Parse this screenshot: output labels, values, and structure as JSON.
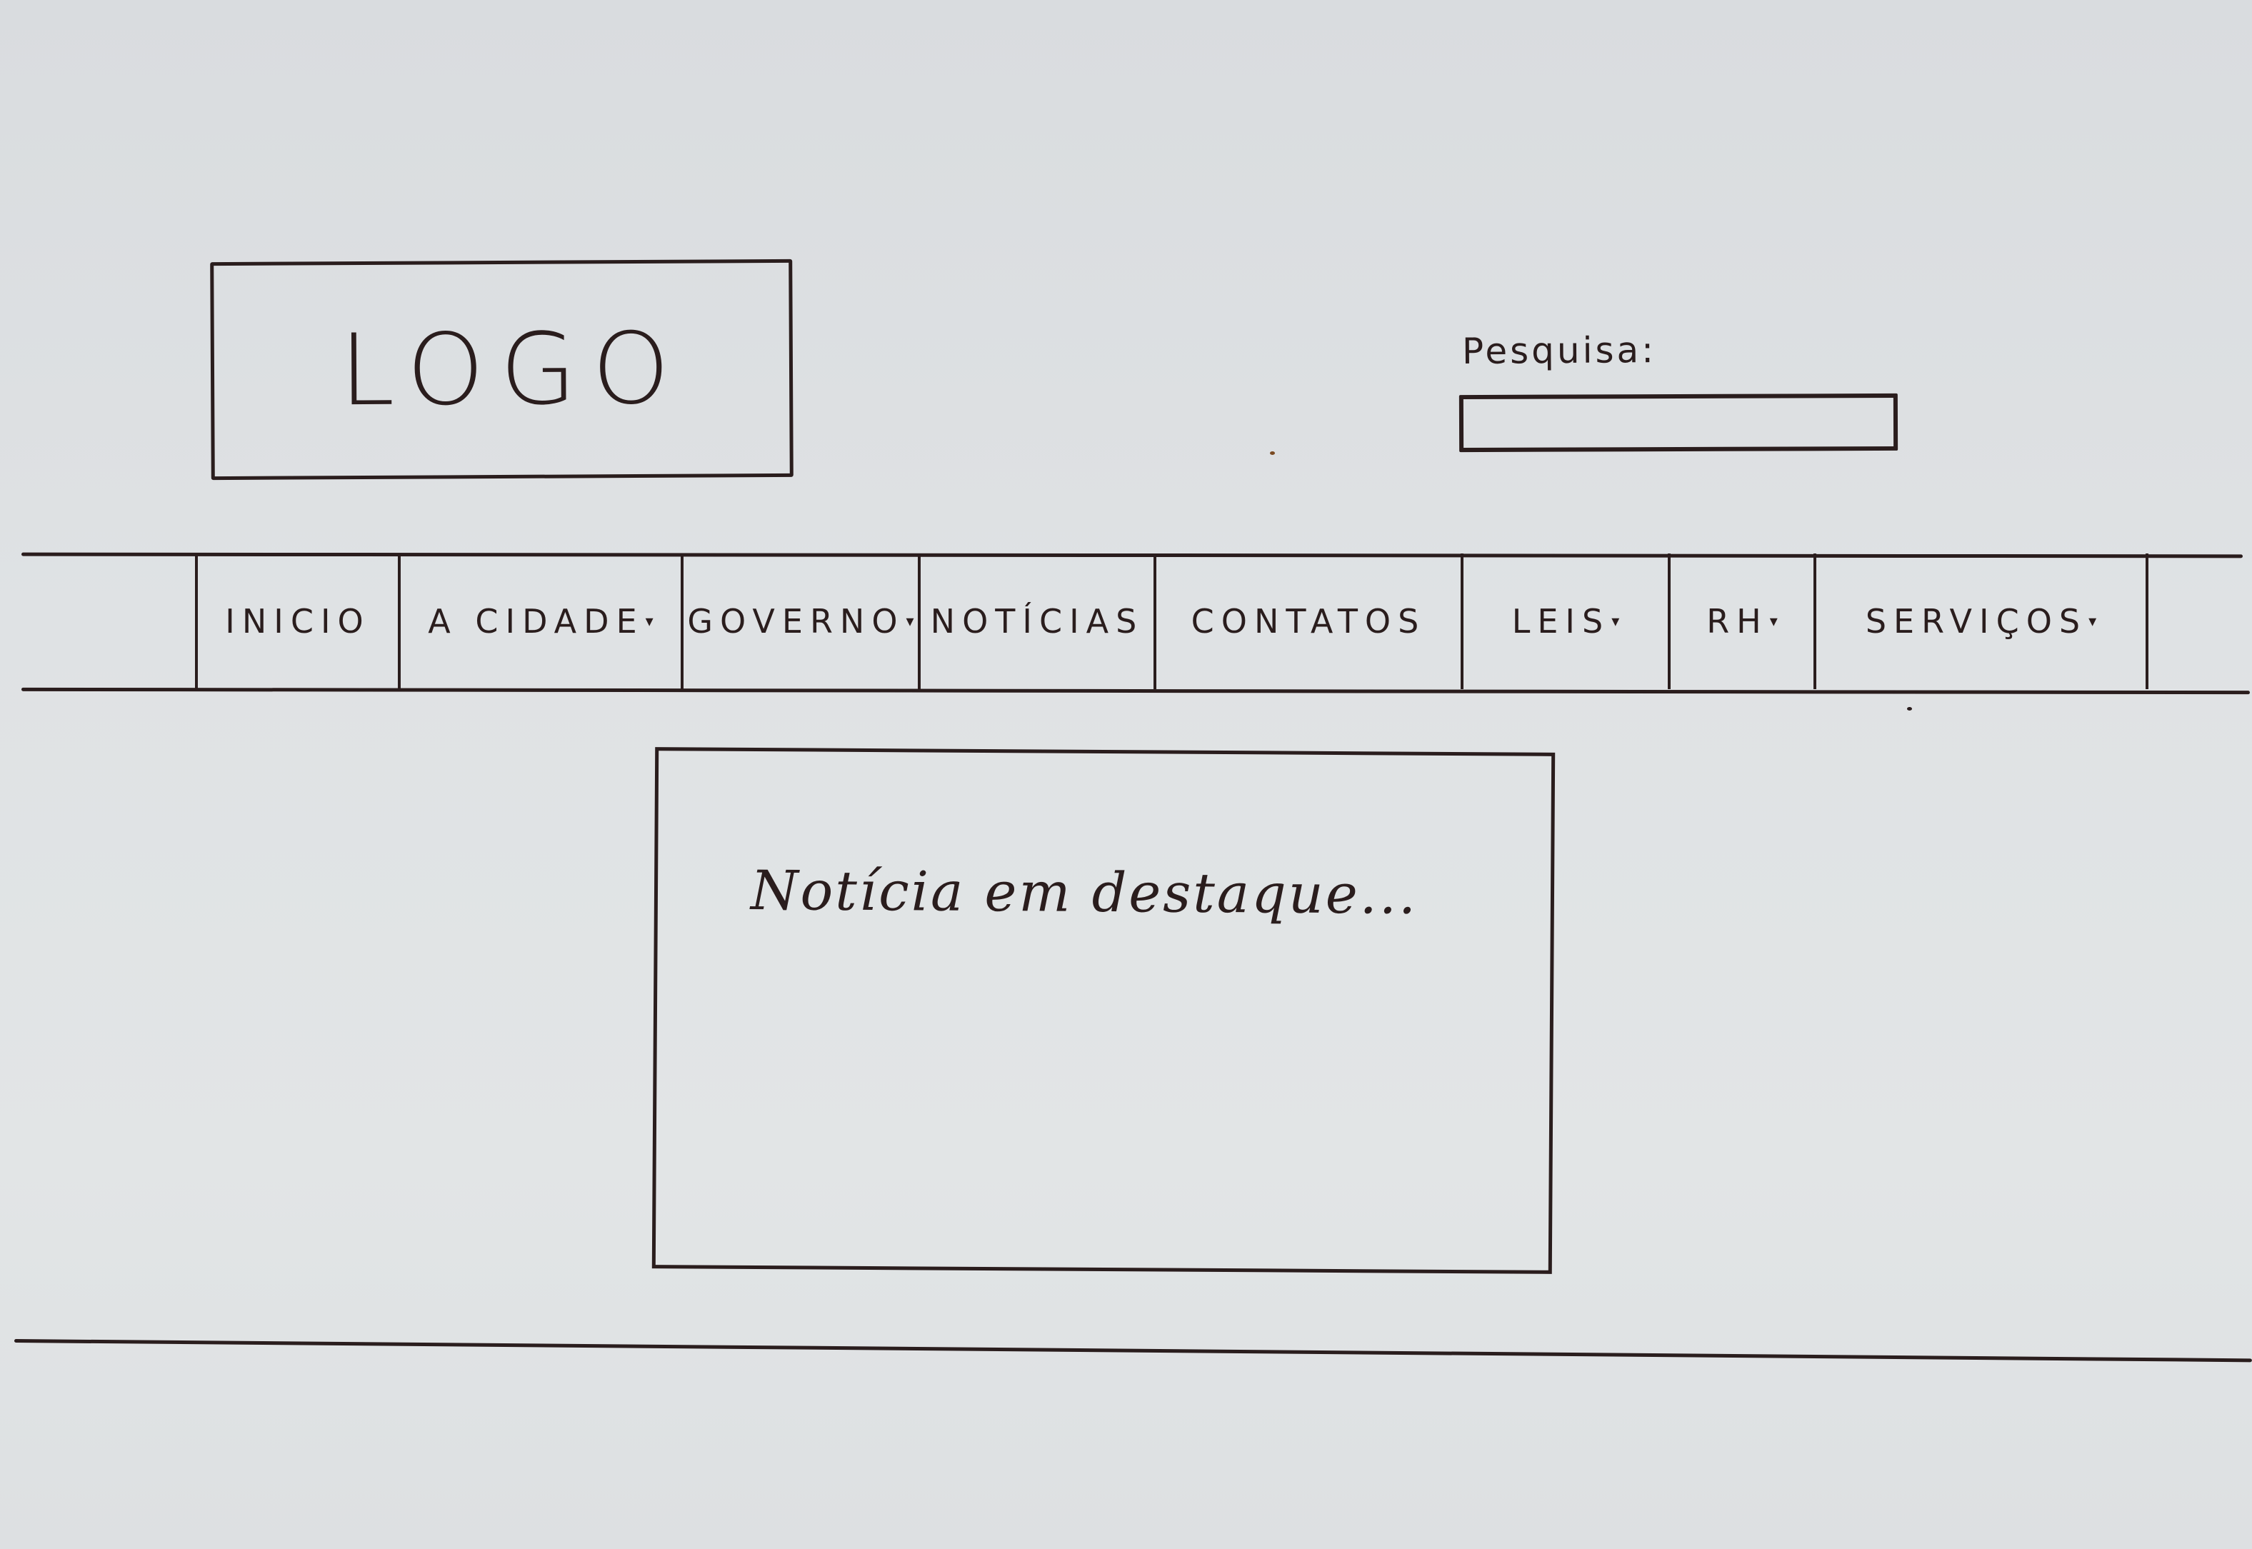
{
  "header": {
    "logo_text": "LOGO",
    "search": {
      "label": "Pesquisa:",
      "value": "",
      "placeholder": ""
    }
  },
  "nav": {
    "items": [
      {
        "label": "INICIO",
        "has_dropdown": false
      },
      {
        "label": "A CIDADE",
        "has_dropdown": true
      },
      {
        "label": "GOVERNO",
        "has_dropdown": true
      },
      {
        "label": "NOTÍCIAS",
        "has_dropdown": false
      },
      {
        "label": "CONTATOS",
        "has_dropdown": false
      },
      {
        "label": "LEIS",
        "has_dropdown": true
      },
      {
        "label": "RH",
        "has_dropdown": true
      },
      {
        "label": "SERVIÇOS",
        "has_dropdown": true
      }
    ],
    "caret_glyph": "▾"
  },
  "main": {
    "featured_news_text": "Notícia em destaque..."
  },
  "colors": {
    "ink": "#2a1d1d",
    "paper": "#dfe2e4"
  }
}
